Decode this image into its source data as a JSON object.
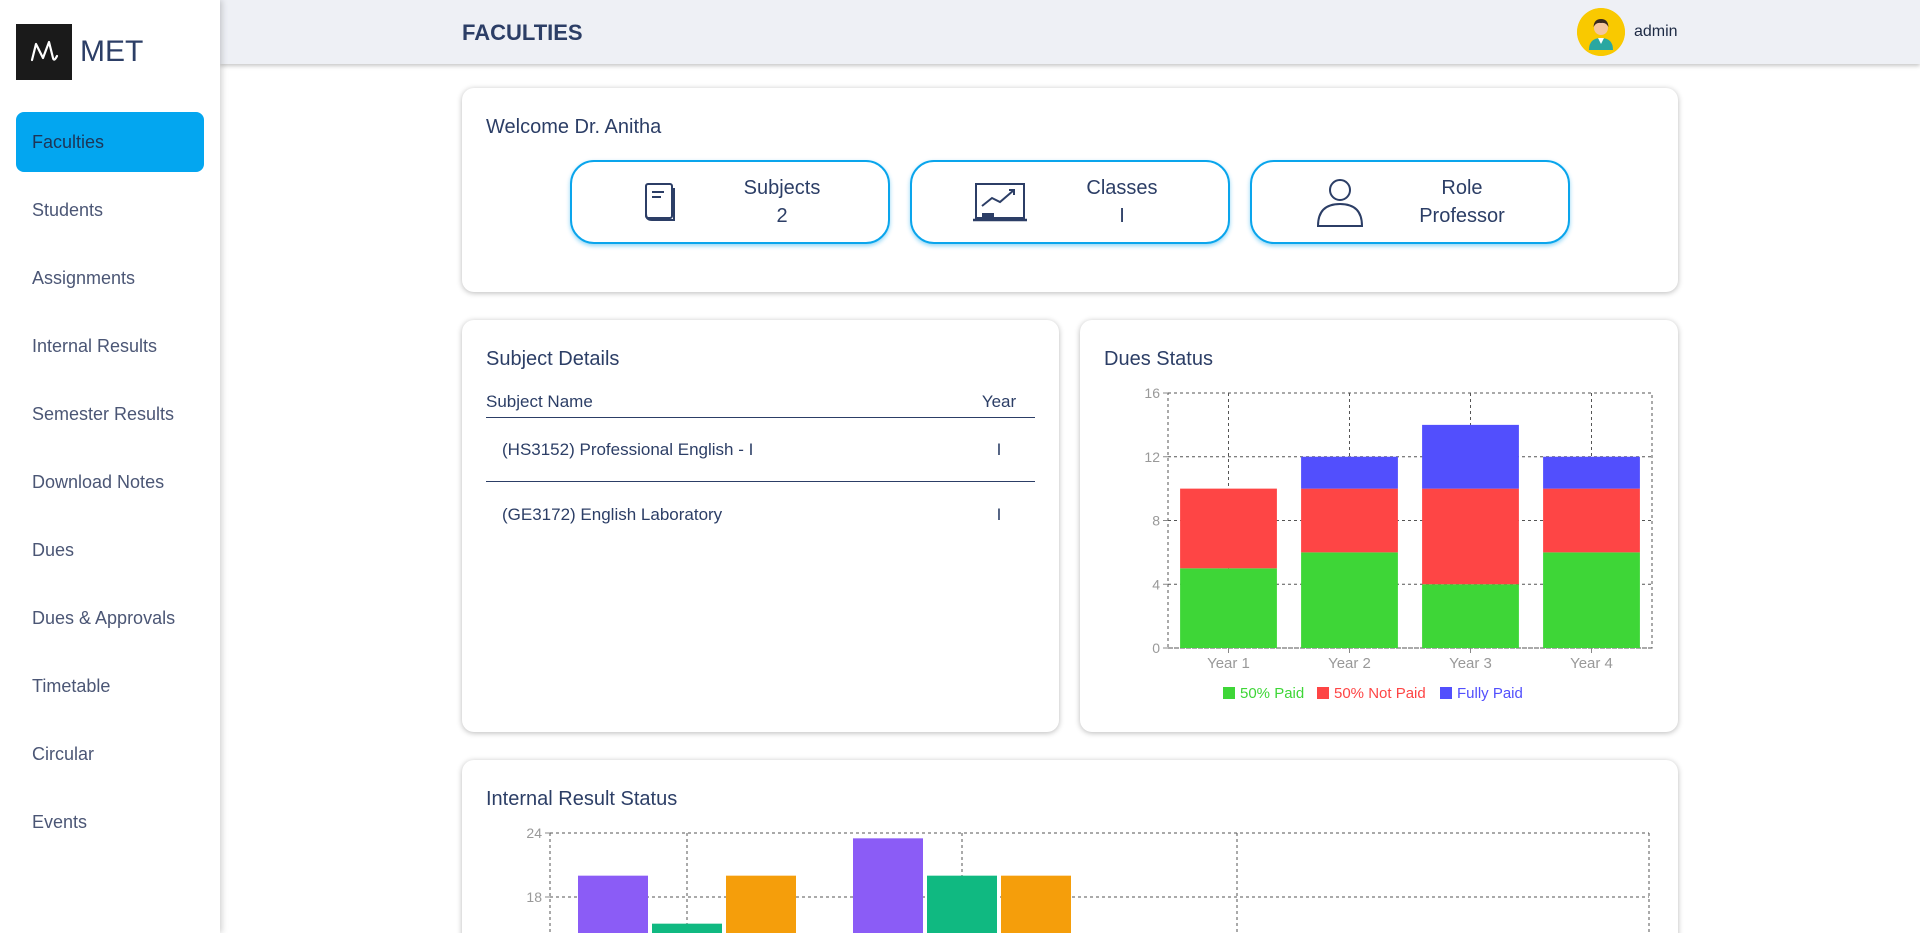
{
  "brand": {
    "name": "MET"
  },
  "sidebar": {
    "items": [
      {
        "label": "Faculties"
      },
      {
        "label": "Students"
      },
      {
        "label": "Assignments"
      },
      {
        "label": "Internal Results"
      },
      {
        "label": "Semester Results"
      },
      {
        "label": "Download Notes"
      },
      {
        "label": "Dues"
      },
      {
        "label": "Dues & Approvals"
      },
      {
        "label": "Timetable"
      },
      {
        "label": "Circular"
      },
      {
        "label": "Events"
      }
    ]
  },
  "header": {
    "title": "FACULTIES",
    "user": "admin"
  },
  "welcome": {
    "title": "Welcome Dr. Anitha",
    "stats": [
      {
        "label": "Subjects",
        "value": "2",
        "icon": "book-icon"
      },
      {
        "label": "Classes",
        "value": "I",
        "icon": "chalkboard-chart-icon"
      },
      {
        "label": "Role",
        "value": "Professor",
        "icon": "user-icon"
      }
    ]
  },
  "subjects": {
    "title": "Subject Details",
    "columns": [
      "Subject Name",
      "Year"
    ],
    "rows": [
      {
        "name": "(HS3152) Professional English - I",
        "year": "I"
      },
      {
        "name": "(GE3172) English Laboratory",
        "year": "I"
      }
    ]
  },
  "dues": {
    "title": "Dues Status"
  },
  "internal": {
    "title": "Internal Result Status"
  },
  "chart_data": [
    {
      "type": "bar",
      "stacked": true,
      "categories": [
        "Year 1",
        "Year 2",
        "Year 3",
        "Year 4"
      ],
      "series": [
        {
          "name": "50% Paid",
          "color": "#3ed637",
          "values": [
            5,
            6,
            4,
            6
          ]
        },
        {
          "name": "50% Not Paid",
          "color": "#fe4545",
          "values": [
            5,
            4,
            6,
            4
          ]
        },
        {
          "name": "Fully Paid",
          "color": "#524ffd",
          "values": [
            0,
            2,
            4,
            2
          ]
        }
      ],
      "ylim": [
        0,
        16
      ],
      "yticks": [
        0,
        4,
        8,
        12,
        16
      ],
      "grid": true,
      "legend": "bottom"
    },
    {
      "type": "bar",
      "yticks": [
        18,
        24
      ],
      "grid": true,
      "series": [
        {
          "color": "#8b5cf6",
          "values": [
            20,
            23.5
          ]
        },
        {
          "color": "#10b981",
          "values": [
            15.5,
            20
          ]
        },
        {
          "color": "#f59e0b",
          "values": [
            20,
            20
          ]
        }
      ]
    }
  ]
}
